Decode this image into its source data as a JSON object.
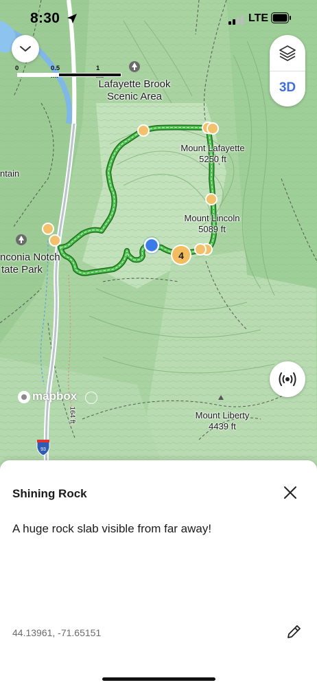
{
  "status_bar": {
    "time": "8:30",
    "network": "LTE"
  },
  "map": {
    "scale": {
      "zero": "0",
      "half": "0.5 mi",
      "one": "1 mi"
    },
    "labels": {
      "lafayette_brook": [
        "Lafayette Brook",
        "Scenic Area"
      ],
      "mount_lafayette": [
        "Mount Lafayette",
        "5250 ft"
      ],
      "mount_lincoln": [
        "Mount Lincoln",
        "5089 ft"
      ],
      "mount_liberty": [
        "Mount Liberty",
        "4439 ft"
      ],
      "franconia_notch": [
        "nconia Notch",
        "tate Park"
      ],
      "mountain_edge": "ntain",
      "road_label": "I-93",
      "elev_small": "164 ft"
    },
    "cluster_count": "4",
    "attribution": "mapbox",
    "view_toggle": "3D",
    "colors": {
      "trail": "#3bb03b",
      "waypoint": "#f3c06c",
      "cluster": "#f3bd5f",
      "user_location": "#3b7be8",
      "accent": "#3f6fd8"
    },
    "icons": {
      "collapse": "chevron-down-icon",
      "layers": "layers-icon",
      "locate": "broadcast-icon",
      "close": "close-icon",
      "edit": "pencil-icon"
    }
  },
  "place": {
    "title": "Shining Rock",
    "description": "A huge rock slab visible from far away!",
    "coordinates": "44.13961, -71.65151"
  }
}
